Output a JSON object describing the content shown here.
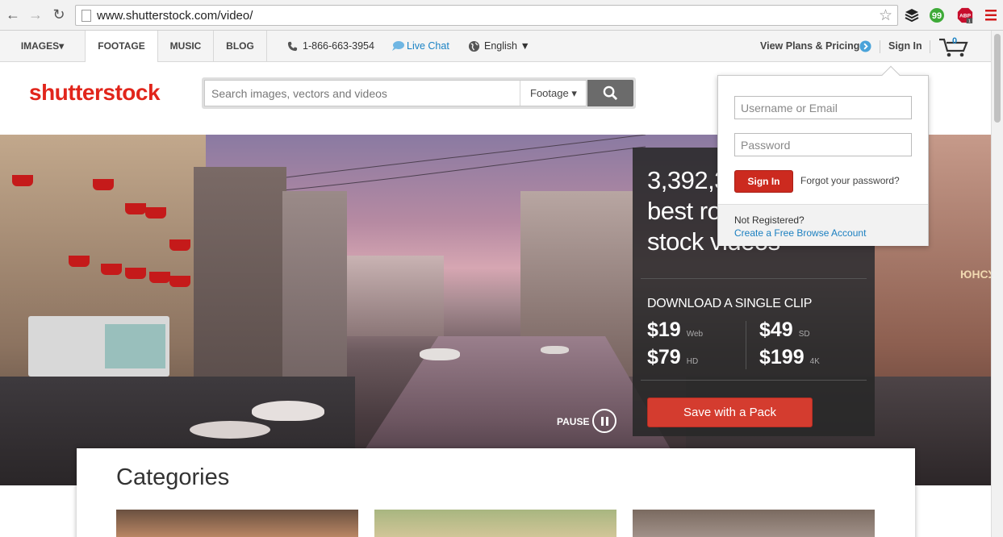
{
  "browser": {
    "url": "www.shutterstock.com/video/",
    "back_icon": "arrow-left-icon",
    "forward_icon": "arrow-right-icon",
    "reload_icon": "reload-icon",
    "bookmark_icon": "star-icon",
    "extensions": [
      "buffer-icon",
      "evernote-icon",
      "adblock-plus-icon",
      "menu-icon"
    ],
    "abp_label": "ABP",
    "abp_count": "1"
  },
  "topnav": {
    "tabs": [
      {
        "label": "IMAGES▾"
      },
      {
        "label": "FOOTAGE"
      },
      {
        "label": "MUSIC"
      },
      {
        "label": "BLOG"
      }
    ],
    "phone": "1-866-663-3954",
    "live_chat": "Live Chat",
    "language": "English ▼",
    "plans": "View Plans & Pricing",
    "sign_in": "Sign In",
    "cart_count": "0"
  },
  "header": {
    "logo": "shutterstock",
    "search_placeholder": "Search images, vectors and videos",
    "search_type": "Footage ▾"
  },
  "hero": {
    "headline": "3,392,3… best ro… stock videos",
    "headline_lines": [
      "3,392,3",
      "best ro",
      "stock videos"
    ],
    "download_title": "DOWNLOAD A SINGLE CLIP",
    "prices": [
      {
        "price": "$19",
        "res": "Web"
      },
      {
        "price": "$49",
        "res": "SD"
      },
      {
        "price": "$79",
        "res": "HD"
      },
      {
        "price": "$199",
        "res": "4K"
      }
    ],
    "cta": "Save with a Pack",
    "pause": "PAUSE",
    "sign_text": "ЮНСУ"
  },
  "categories": {
    "title": "Categories"
  },
  "signin_popover": {
    "username_placeholder": "Username or Email",
    "password_placeholder": "Password",
    "signin_button": "Sign In",
    "forgot": "Forgot your password?",
    "not_registered": "Not Registered?",
    "create_account": "Create a Free Browse Account"
  },
  "colors": {
    "brand_red": "#e1251b",
    "link_blue": "#1a82c4",
    "promo_button": "#d43c2f"
  }
}
